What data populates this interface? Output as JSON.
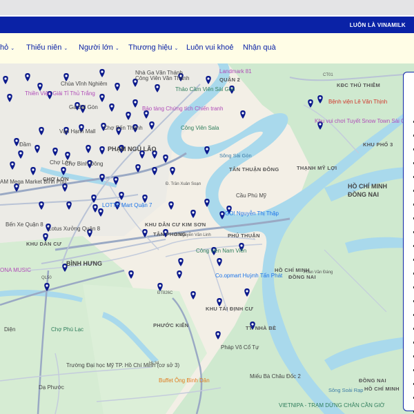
{
  "top_bar": {
    "slogan": "LUÔN LÀ VINAMILK"
  },
  "nav": {
    "items": [
      {
        "label": "hỏ",
        "dropdown": true
      },
      {
        "label": "Thiếu niên",
        "dropdown": true
      },
      {
        "label": "Người lớn",
        "dropdown": true
      },
      {
        "label": "Thương hiệu",
        "dropdown": true
      },
      {
        "label": "Luôn vui khoẻ",
        "dropdown": false
      },
      {
        "label": "Nhận quà",
        "dropdown": false
      }
    ],
    "chevron": "⌄"
  },
  "colors": {
    "brand_blue": "#0a22a6",
    "nav_bg": "#fffde6",
    "pin": "#0c1a8c",
    "water": "#a9d9ec",
    "green_area": "#cdebd2"
  },
  "map": {
    "labels": [
      {
        "text": "Chùa Vĩnh Nghiêm",
        "cls": ""
      },
      {
        "text": "Nhà Ga Văn Thánh",
        "cls": ""
      },
      {
        "text": "Công Viên Văn Thánh",
        "cls": ""
      },
      {
        "text": "Landmark 81",
        "cls": "poi-pink"
      },
      {
        "text": "QUẬN 2",
        "cls": "district"
      },
      {
        "text": "KĐC THỦ THIÊM",
        "cls": "district"
      },
      {
        "text": "Thiền Viện Giải Tỉ Thủ Trắng",
        "cls": "poi-pink"
      },
      {
        "text": "Ga Sài Gòn",
        "cls": ""
      },
      {
        "text": "Thảo Cầm Viên Sài Gòn",
        "cls": "poi"
      },
      {
        "text": "Bảo tàng Chứng tích Chiến tranh",
        "cls": "poi-pink"
      },
      {
        "text": "Bệnh viện Lê Văn Thịnh",
        "cls": "poi-red"
      },
      {
        "text": "Chợ Bến Thành",
        "cls": ""
      },
      {
        "text": "Công Viên Sala",
        "cls": "poi"
      },
      {
        "text": "Khu vui chơi Tuyết Snow Town Sài Gòn",
        "cls": "poi-pink"
      },
      {
        "text": "Vạn Hạnh Mall",
        "cls": ""
      },
      {
        "text": "PHẠM NGŨ LÃO",
        "cls": "big"
      },
      {
        "text": "KHU PHỐ 3",
        "cls": "district"
      },
      {
        "text": "Đầm",
        "cls": ""
      },
      {
        "text": "Chợ Lớn",
        "cls": ""
      },
      {
        "text": "Chợ Bình Đông",
        "cls": ""
      },
      {
        "text": "Sông Sài Gòn",
        "cls": "water"
      },
      {
        "text": "TÂN THUẬN ĐÔNG",
        "cls": "district"
      },
      {
        "text": "THẠNH MỸ LỢI",
        "cls": "district"
      },
      {
        "text": "CHỢ LỚN",
        "cls": "district"
      },
      {
        "text": "HỒ CHÍ MINH",
        "cls": "big"
      },
      {
        "text": "ĐỒNG NAI",
        "cls": "big"
      },
      {
        "text": "AM Mega Market Bình Phú",
        "cls": ""
      },
      {
        "text": "LOTTE Mart Quận 7",
        "cls": "poi-blue"
      },
      {
        "text": "Cầu Phú Mỹ",
        "cls": ""
      },
      {
        "text": "GO! Nguyễn Thị Thập",
        "cls": "poi-blue"
      },
      {
        "text": "Bến Xe Quận 8",
        "cls": ""
      },
      {
        "text": "KHU DÂN CƯ KIM SƠN",
        "cls": "district"
      },
      {
        "text": "TÂN PHONG",
        "cls": "district"
      },
      {
        "text": "PHÚ THUẬN",
        "cls": "district"
      },
      {
        "text": "KHU DÂN CƯ",
        "cls": "district"
      },
      {
        "text": "BÌNH HƯNG",
        "cls": "big"
      },
      {
        "text": "ONA MUSIC",
        "cls": "poi-pink"
      },
      {
        "text": "Công viên Nam Viên",
        "cls": "poi"
      },
      {
        "text": "Co.opmart Huỳnh Tấn Phát",
        "cls": "poi-blue"
      },
      {
        "text": "HỒ CHÍ MINH",
        "cls": "district"
      },
      {
        "text": "ĐỒNG NAI",
        "cls": "district"
      },
      {
        "text": "KHU TÁI ĐỊNH CƯ",
        "cls": "district"
      },
      {
        "text": "PHƯỚC KIỂN",
        "cls": "district"
      },
      {
        "text": "TT. NHÀ BÈ",
        "cls": "district"
      },
      {
        "text": "Chợ Phú Lạc",
        "cls": "poi"
      },
      {
        "text": "Pháp Võ Cổ Tự",
        "cls": ""
      },
      {
        "text": "Trường Đại học Mỹ TP. Hồ Chí Minh (cơ sở 3)",
        "cls": ""
      },
      {
        "text": "Buffet Ông Bình Dân",
        "cls": "poi-orange"
      },
      {
        "text": "Miếu Bà Châu Đốc 2",
        "cls": ""
      },
      {
        "text": "Dạ Phước",
        "cls": ""
      },
      {
        "text": "ĐỒNG NAI",
        "cls": "district"
      },
      {
        "text": "HỒ CHÍ MINH",
        "cls": "district"
      },
      {
        "text": "Diện",
        "cls": ""
      },
      {
        "text": "Đ. Trần Xuân Soạn",
        "cls": "road"
      },
      {
        "text": "Đ. Nguyễn Văn Linh",
        "cls": "road"
      },
      {
        "text": "Phan Văn Đáng",
        "cls": "road"
      },
      {
        "text": "VIETNIPA - TRẠM DỪNG CHÂN CẦN GIỜ",
        "cls": "poi"
      },
      {
        "text": "Lotus Xưởng Quận 8",
        "cls": ""
      },
      {
        "text": "ĐT826C",
        "cls": "road"
      },
      {
        "text": "HL34",
        "cls": "road"
      },
      {
        "text": "QL50",
        "cls": "road"
      },
      {
        "text": "CT01",
        "cls": "road"
      },
      {
        "text": "Sông Soài Rạp",
        "cls": "water"
      }
    ],
    "pin_count": 86
  }
}
